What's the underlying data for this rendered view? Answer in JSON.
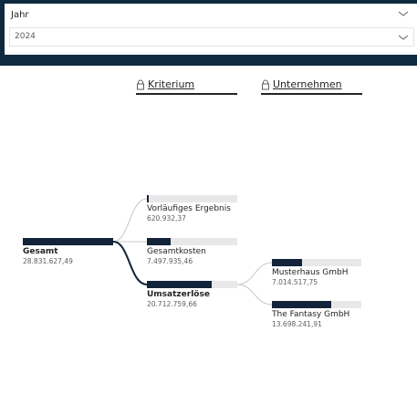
{
  "slicer": {
    "title": "Jahr",
    "selected": "2024",
    "icons": [
      "chevron-down-icon",
      "chevron-down-icon"
    ]
  },
  "tree": {
    "headers": [
      {
        "label": "Kriterium",
        "icon": "lock-icon"
      },
      {
        "label": "Unternehmen",
        "icon": "lock-icon"
      }
    ],
    "root": {
      "name": "Gesamt",
      "value": "28.831.627,49",
      "fraction": 1.0
    },
    "level1": [
      {
        "name": "Vorläufiges Ergebnis",
        "value": "620.932,37",
        "fraction": 0.02
      },
      {
        "name": "Gesamtkosten",
        "value": "7.497.935,46",
        "fraction": 0.26
      },
      {
        "name": "Umsatzerlöse",
        "value": "20.712.759,66",
        "fraction": 0.72,
        "selected": true
      }
    ],
    "level2": [
      {
        "name": "Musterhaus GmbH",
        "value": "7.014.517,75",
        "fraction": 0.34
      },
      {
        "name": "The Fantasy GmbH",
        "value": "13.698.241,91",
        "fraction": 0.66
      }
    ],
    "colors": {
      "bar": "#12233a",
      "track": "#e8e8e8",
      "link": "#12233a",
      "link_light": "#c8c8c8"
    }
  }
}
